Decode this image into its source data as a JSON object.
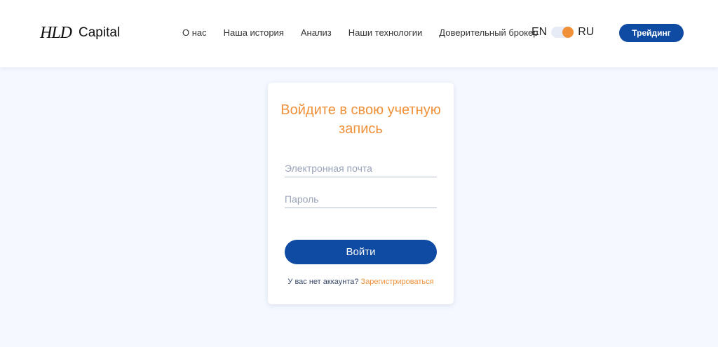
{
  "header": {
    "logo_mark": "HLD",
    "logo_text": "Capital",
    "nav": [
      {
        "label": "О нас"
      },
      {
        "label": "Наша история"
      },
      {
        "label": "Анализ"
      },
      {
        "label": "Наши технологии"
      },
      {
        "label": "Доверительный брокер"
      }
    ],
    "lang_en": "EN",
    "lang_ru": "RU",
    "trade_button": "Трейдинг"
  },
  "login": {
    "title": "Войдите в свою учетную запись",
    "email_placeholder": "Электронная почта",
    "password_placeholder": "Пароль",
    "submit": "Войти",
    "no_account": "У вас нет аккаунта?",
    "register_link": "Зарегистрироваться"
  },
  "colors": {
    "accent": "#f0913a",
    "primary": "#0f4aa3",
    "background": "#f5f8ff"
  }
}
